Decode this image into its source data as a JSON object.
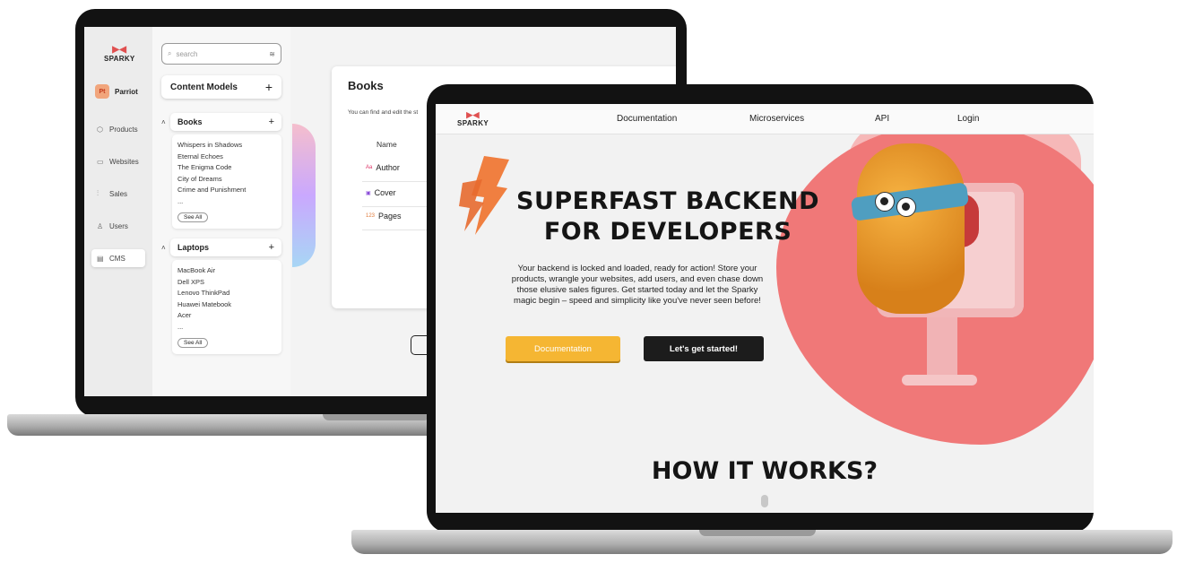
{
  "cms": {
    "logo": "SPARKY",
    "user": {
      "initials": "Pt",
      "name": "Parriot"
    },
    "nav": [
      {
        "label": "Products",
        "icon": "cube-icon"
      },
      {
        "label": "Websites",
        "icon": "monitor-icon"
      },
      {
        "label": "Sales",
        "icon": "chart-icon"
      },
      {
        "label": "Users",
        "icon": "user-icon"
      },
      {
        "label": "CMS",
        "icon": "document-icon"
      }
    ],
    "search_placeholder": "search",
    "content_models_label": "Content Models",
    "groups": [
      {
        "title": "Books",
        "items": [
          "Whispers in Shadows",
          "Eternal Echoes",
          "The Enigma Code",
          "City of Dreams",
          "Crime and Punishment",
          "..."
        ],
        "see_all": "See All"
      },
      {
        "title": "Laptops",
        "items": [
          "MacBook Air",
          "Dell XPS",
          "Lenovo ThinkPad",
          "Huawei Matebook",
          "Acer",
          "..."
        ],
        "see_all": "See All"
      }
    ],
    "main": {
      "title": "Books",
      "description": "You can find and edit the st",
      "name_header": "Name",
      "fields": [
        {
          "type": "Aa",
          "label": "Author"
        },
        {
          "type": "▣",
          "label": "Cover"
        },
        {
          "type": "123",
          "label": "Pages"
        }
      ]
    }
  },
  "site": {
    "logo": "SPARKY",
    "nav": [
      "Documentation",
      "Microservices",
      "API",
      "Login"
    ],
    "hero_line1": "Superfast Backend",
    "hero_line2": "for Developers",
    "description": "Your backend is locked and loaded, ready for action! Store your products, wrangle your websites, add users, and even chase down those elusive sales figures. Get started today and let the Sparky magic begin – speed and simplicity like you've never seen before!",
    "primary_button": "Documentation",
    "secondary_button": "Let's get started!",
    "section_heading": "How it works?"
  },
  "colors": {
    "accent_yellow": "#f5b633",
    "blob_red": "#f07878",
    "dark": "#1c1c1c"
  }
}
